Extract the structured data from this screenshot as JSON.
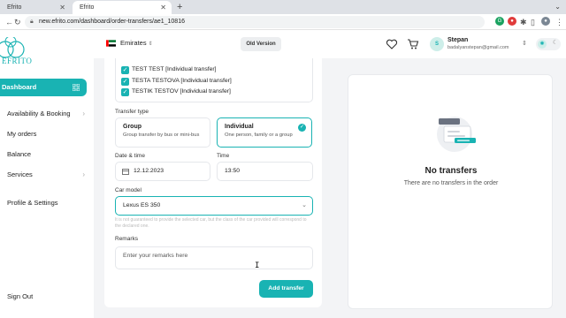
{
  "browser": {
    "tabs": [
      {
        "title": "Efrito"
      },
      {
        "title": "Efrito"
      }
    ],
    "url": "new.efrito.com/dashboard/order-transfers/ae1_10816"
  },
  "sidebar": {
    "logo_text": "EFRITO",
    "items": [
      {
        "label": "Dashboard",
        "active": true
      },
      {
        "label": "Availability & Booking",
        "has_chevron": true
      },
      {
        "label": "My orders"
      },
      {
        "label": "Balance"
      },
      {
        "label": "Services",
        "has_chevron": true
      },
      {
        "label": "Profile & Settings"
      },
      {
        "label": "Sign Out"
      }
    ]
  },
  "header": {
    "country": "Emirates",
    "old_version_label": "Old Version",
    "user": {
      "initial": "S",
      "name": "Stepan",
      "email": "badalyanstepan@gmail.com"
    }
  },
  "form": {
    "passengers": [
      "TEST TEST [Individual transfer]",
      "TESTA TESTOVA [Individual transfer]",
      "TESTIK TESTOV [Individual transfer]"
    ],
    "transfer_type_label": "Transfer type",
    "transfer_types": [
      {
        "title": "Group",
        "desc": "Group transfer by bus or mini-bus",
        "selected": false
      },
      {
        "title": "Individual",
        "desc": "One person, family or a group",
        "selected": true
      }
    ],
    "date_label": "Date & time",
    "date_value": "12.12.2023",
    "time_label": "Time",
    "time_value": "13:50",
    "car_label": "Car model",
    "car_value": "Lexus ES 350",
    "car_hint": "It is not guaranteed to provide the selected car, but the class of the car provided will correspond to the declared one.",
    "remarks_label": "Remarks",
    "remarks_placeholder": "Enter your remarks here",
    "submit_label": "Add transfer"
  },
  "transfers_panel": {
    "title": "No transfers",
    "desc": "There are no transfers in the order"
  },
  "colors": {
    "accent": "#19b3b3"
  }
}
